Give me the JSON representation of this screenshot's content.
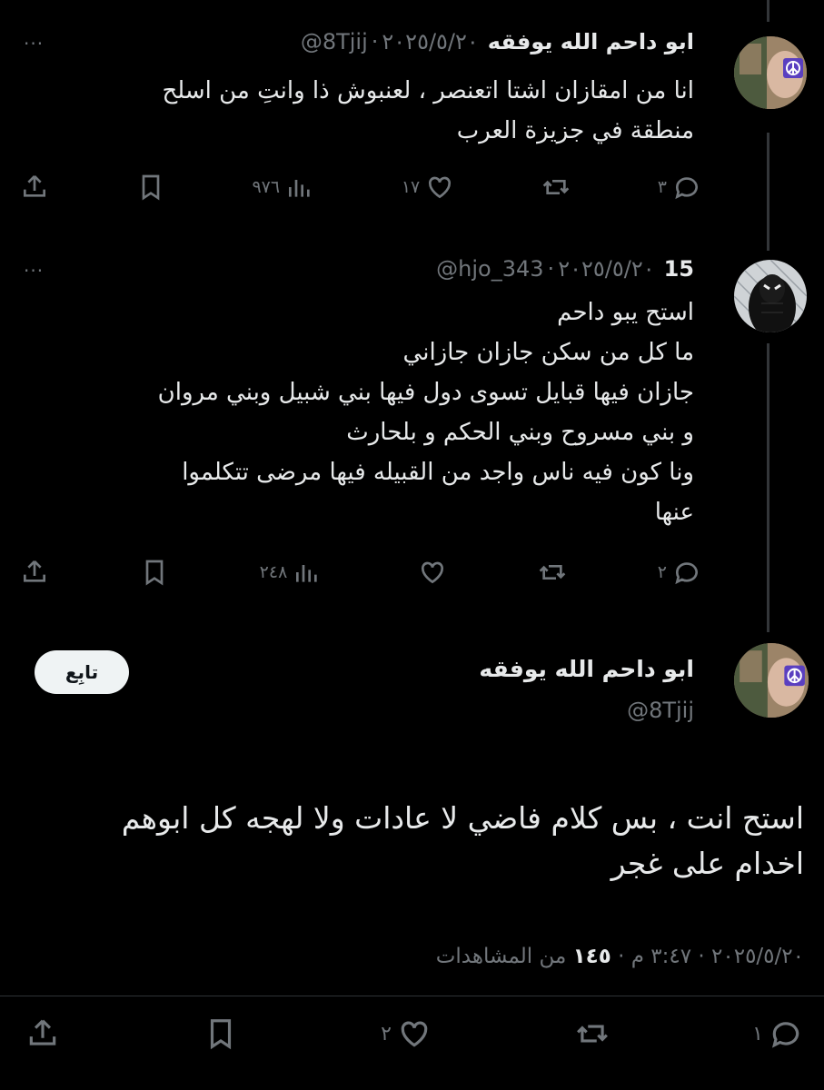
{
  "colors": {
    "background": "#000000",
    "text": "#e7e9ea",
    "muted": "#71767b",
    "follow_bg": "#eff3f4"
  },
  "reply1": {
    "display_name": "ابو داحم الله يوفقه",
    "handle": "@8Tjij",
    "date": "٢٠٢٥/٥/٢٠",
    "text_lines": [
      "انا من  امقازان اشتا اتعنصر ، لعنبوش ذا وانتِ من اسلح",
      "منطقة في جزيزة العرب"
    ],
    "more_label": "···",
    "actions": {
      "replies": "٣",
      "retweets": "",
      "likes": "١٧",
      "views": "٩٧٦"
    },
    "icons": [
      "reply-icon",
      "retweet-icon",
      "like-icon",
      "views-icon",
      "bookmark-icon",
      "share-icon"
    ]
  },
  "reply2": {
    "display_name": "15",
    "handle": "@hjo_343",
    "date": "٢٠٢٥/٥/٢٠",
    "text_lines": [
      "استح يبو داحم",
      "ما كل من سكن جازان جازاني",
      "جازان فيها قبايل تسوى دول فيها بني شبيل وبني مروان",
      "و بني مسروح وبني الحكم و بلحارث",
      "ونا كون فيه ناس واجد من القبيله فيها مرضى تتكلموا",
      "عنها"
    ],
    "more_label": "···",
    "actions": {
      "replies": "٢",
      "retweets": "",
      "likes": "",
      "views": "٢٤٨"
    }
  },
  "main_tweet": {
    "display_name": "ابو داحم الله يوفقه",
    "handle": "@8Tjij",
    "follow_label": "تابِع",
    "text_lines": [
      "استح انت ، بس كلام فاضي لا عادات ولا لهجه كل ابوهم",
      "اخدام على غجر"
    ],
    "date": "٢٠٢٥/٥/٢٠",
    "time": "٣:٤٧ م",
    "views_count": "١٤٥",
    "views_label": "من المشاهدات",
    "dot": "·",
    "actions": {
      "replies": "١",
      "retweets": "",
      "likes": "٢"
    }
  }
}
